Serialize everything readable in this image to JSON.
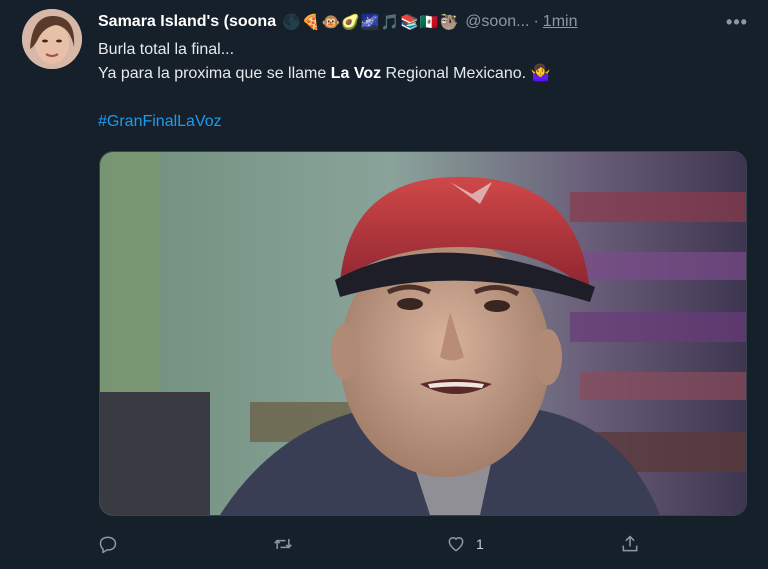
{
  "tweet": {
    "author_name": "Samara Island's (soona",
    "author_emojis": "🌑🍕🐵🥑🌌🎵📚🇲🇽🦥",
    "handle": "@soon...",
    "separator": "·",
    "time": "1min",
    "more_label": "•••",
    "line1": "Burla total la final...",
    "line2_prefix": "Ya para la proxima que se llame ",
    "line2_bold": "La Voz",
    "line2_suffix": " Regional Mexicano. 🤷‍♀️",
    "hashtag": "#GranFinalLaVoz"
  },
  "actions": {
    "reply_count": "",
    "retweet_count": "",
    "like_count": "1",
    "share_count": ""
  },
  "colors": {
    "background": "#15202b",
    "link": "#1d9bf0",
    "muted": "#8b98a5"
  },
  "icons": [
    "reply-icon",
    "retweet-icon",
    "like-icon",
    "share-icon",
    "more-options-icon"
  ]
}
